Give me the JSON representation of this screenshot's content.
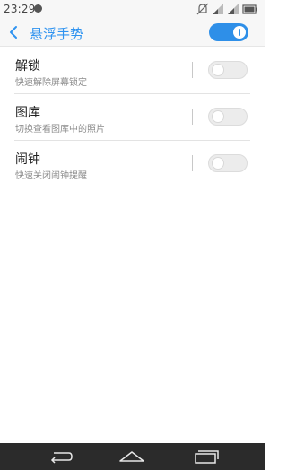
{
  "status_bar": {
    "time": "23:29",
    "app_icon": "notification-dot-icon",
    "right_icons": [
      "silent-icon",
      "signal-1-icon",
      "signal-2-icon",
      "battery-icon"
    ]
  },
  "header": {
    "back_icon": "chevron-left-icon",
    "title": "悬浮手势",
    "master_toggle_on": true,
    "accent_color": "#2f93f0"
  },
  "settings": [
    {
      "title": "解锁",
      "description": "快速解除屏幕锁定",
      "enabled": false
    },
    {
      "title": "图库",
      "description": "切换查看图库中的照片",
      "enabled": false
    },
    {
      "title": "闹钟",
      "description": "快速关闭闹钟提醒",
      "enabled": false
    }
  ],
  "nav_bar": {
    "buttons": [
      "back-arrow-icon",
      "home-icon",
      "recent-apps-icon"
    ]
  }
}
